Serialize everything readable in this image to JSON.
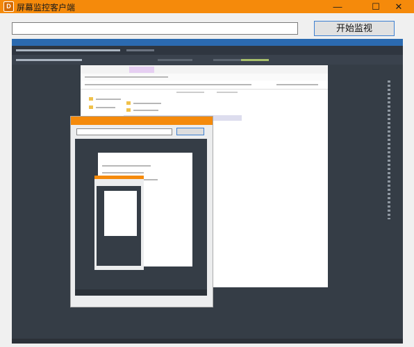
{
  "window": {
    "title": "屏幕监控客户端",
    "app_icon_letter": "D"
  },
  "controls": {
    "minimize": "—",
    "maximize": "☐",
    "close": "✕"
  },
  "toolbar": {
    "url_value": "",
    "url_placeholder": "",
    "start_button_label": "开始监视"
  },
  "colors": {
    "accent": "#f58a0b",
    "ide_bg": "#353d46",
    "ide_header": "#2b6ab0",
    "button_border": "#3c7fd1"
  },
  "icons": [
    "app-icon",
    "minimize-icon",
    "maximize-icon",
    "close-icon",
    "folder-icon"
  ]
}
